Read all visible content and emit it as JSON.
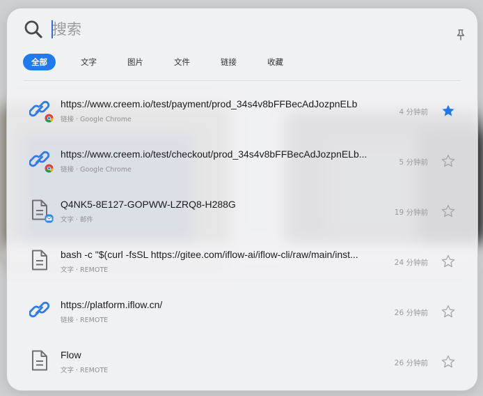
{
  "search": {
    "placeholder": "搜索"
  },
  "tabs": [
    {
      "label": "全部",
      "active": true
    },
    {
      "label": "文字",
      "active": false
    },
    {
      "label": "图片",
      "active": false
    },
    {
      "label": "文件",
      "active": false
    },
    {
      "label": "链接",
      "active": false
    },
    {
      "label": "收藏",
      "active": false
    }
  ],
  "items": [
    {
      "icon": "link-icon",
      "badge": "chrome-icon",
      "title": "https://www.creem.io/test/payment/prod_34s4v8bFFBecAdJozpnELb",
      "subtitle": "链接 · Google Chrome",
      "time": "4 分钟前",
      "starred": true
    },
    {
      "icon": "link-icon",
      "badge": "chrome-icon",
      "title": "https://www.creem.io/test/checkout/prod_34s4v8bFFBecAdJozpnELb...",
      "subtitle": "链接 · Google Chrome",
      "time": "5 分钟前",
      "starred": false
    },
    {
      "icon": "document-icon",
      "badge": "mail-icon",
      "title": "Q4NK5-8E127-GOPWW-LZRQ8-H288G",
      "subtitle": "文字 · 邮件",
      "time": "19 分钟前",
      "starred": false
    },
    {
      "icon": "document-icon",
      "badge": "",
      "title": "bash -c \"$(curl -fsSL https://gitee.com/iflow-ai/iflow-cli/raw/main/inst...",
      "subtitle": "文字 · REMOTE",
      "time": "24 分钟前",
      "starred": false
    },
    {
      "icon": "link-icon",
      "badge": "",
      "title": "https://platform.iflow.cn/",
      "subtitle": "链接 · REMOTE",
      "time": "26 分钟前",
      "starred": false
    },
    {
      "icon": "document-icon",
      "badge": "",
      "title": "Flow",
      "subtitle": "文字 · REMOTE",
      "time": "26 分钟前",
      "starred": false
    }
  ],
  "colors": {
    "accent": "#1f7af0",
    "star_active": "#1f7af0",
    "link_icon": "#2f7bea"
  }
}
